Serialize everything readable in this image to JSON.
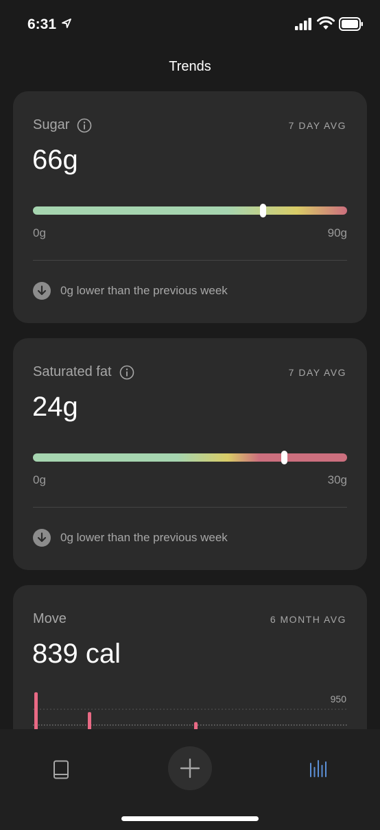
{
  "status": {
    "time": "6:31"
  },
  "header": {
    "title": "Trends"
  },
  "cards": [
    {
      "title": "Sugar",
      "avg_label": "7 DAY AVG",
      "value": "66g",
      "range_min": "0g",
      "range_max": "90g",
      "level": 66,
      "scale_max": 90,
      "change_text": "0g lower than the previous week"
    },
    {
      "title": "Saturated fat",
      "avg_label": "7 DAY AVG",
      "value": "24g",
      "range_min": "0g",
      "range_max": "30g",
      "level": 24,
      "scale_max": 30,
      "change_text": "0g lower than the previous week"
    },
    {
      "title": "Move",
      "avg_label": "6 MONTH AVG",
      "value": "839 cal",
      "chart_max_label": "950"
    }
  ],
  "chart_data": {
    "type": "bar",
    "values": [
      1070,
      930,
      860
    ],
    "reference_lines": [
      950,
      839
    ],
    "ylim": [
      800,
      1100
    ]
  },
  "colors": {
    "accent_blue": "#5b8fd6",
    "bar_pink": "#e96a85",
    "range_green": "#a6d5b0",
    "range_yellow": "#d9cc67",
    "range_red": "#cc6f7e"
  },
  "tabs": [
    {
      "name": "journal",
      "icon": "book-icon",
      "active": false
    },
    {
      "name": "add",
      "icon": "plus-icon",
      "active": false
    },
    {
      "name": "trends",
      "icon": "bar-chart-icon",
      "active": true
    }
  ]
}
